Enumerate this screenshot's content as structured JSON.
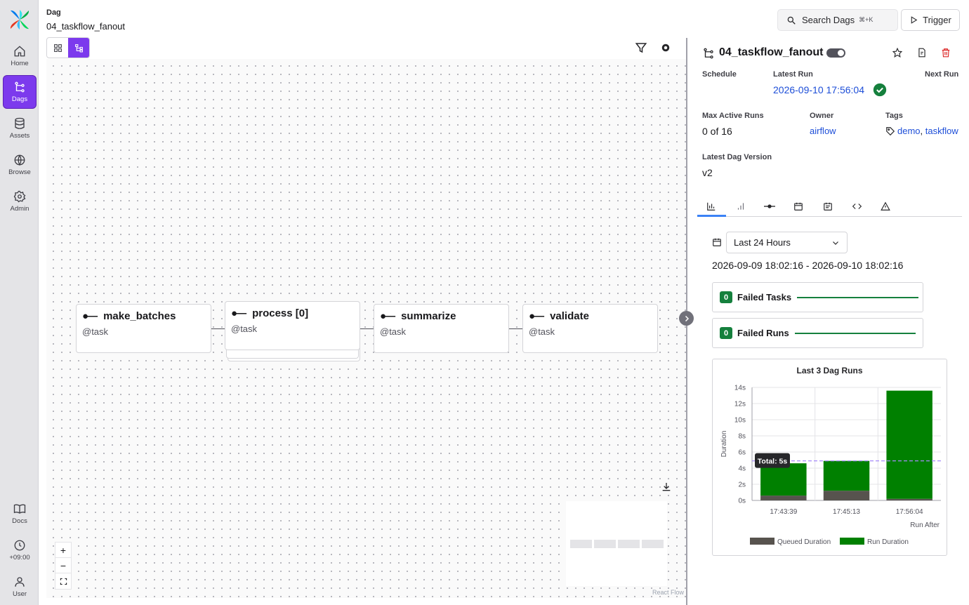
{
  "header": {
    "breadcrumb_label": "Dag",
    "breadcrumb_value": "04_taskflow_fanout",
    "search_label": "Search Dags",
    "search_shortcut": "⌘+K",
    "trigger_label": "Trigger"
  },
  "nav": {
    "items": [
      {
        "label": "Home",
        "icon": "home-icon"
      },
      {
        "label": "Dags",
        "icon": "dags-icon"
      },
      {
        "label": "Assets",
        "icon": "database-icon"
      },
      {
        "label": "Browse",
        "icon": "globe-icon"
      },
      {
        "label": "Admin",
        "icon": "gear-icon"
      }
    ],
    "bottom_items": [
      {
        "label": "Docs",
        "icon": "book-icon"
      },
      {
        "label": "+09:00",
        "icon": "clock-icon"
      },
      {
        "label": "User",
        "icon": "user-icon"
      }
    ]
  },
  "graph": {
    "nodes": [
      {
        "name": "make_batches",
        "type": "@task"
      },
      {
        "name": "process [0]",
        "type": "@task"
      },
      {
        "name": "summarize",
        "type": "@task"
      },
      {
        "name": "validate",
        "type": "@task"
      }
    ],
    "attribution": "React Flow"
  },
  "details": {
    "title": "04_taskflow_fanout",
    "schedule_label": "Schedule",
    "latest_run_label": "Latest Run",
    "latest_run_value": "2026-09-10 17:56:04",
    "next_run_label": "Next Run",
    "max_active_runs_label": "Max Active Runs",
    "max_active_runs_value": "0 of 16",
    "owner_label": "Owner",
    "owner_value": "airflow",
    "tags_label": "Tags",
    "tags": [
      "demo",
      "taskflow"
    ],
    "latest_version_label": "Latest Dag Version",
    "latest_version_value": "v2",
    "time_range_selected": "Last 24 Hours",
    "date_range": "2026-09-09 18:02:16 - 2026-09-10 18:02:16",
    "failed_tasks_count": "0",
    "failed_tasks_label": "Failed Tasks",
    "failed_runs_count": "0",
    "failed_runs_label": "Failed Runs"
  },
  "colors": {
    "accent": "#7c3aed",
    "success": "#15803d",
    "run_duration": "#008000",
    "queued_duration": "#57534e",
    "link": "#1d4ed8"
  },
  "chart_data": {
    "type": "bar",
    "title": "Last 3 Dag Runs",
    "xlabel": "Run After",
    "ylabel": "Duration",
    "categories": [
      "17:43:39",
      "17:45:13",
      "17:56:04"
    ],
    "series": [
      {
        "name": "Queued Duration",
        "values": [
          0.6,
          1.2,
          0.2
        ]
      },
      {
        "name": "Run Duration",
        "values": [
          4.0,
          3.7,
          13.4
        ]
      }
    ],
    "y_ticks": [
      "0s",
      "2s",
      "4s",
      "6s",
      "8s",
      "10s",
      "12s",
      "14s"
    ],
    "ylim": [
      0,
      14
    ],
    "stacked": true,
    "reference_line": {
      "value": 4.9,
      "label": "Total: 5s"
    },
    "legend_position": "bottom"
  }
}
